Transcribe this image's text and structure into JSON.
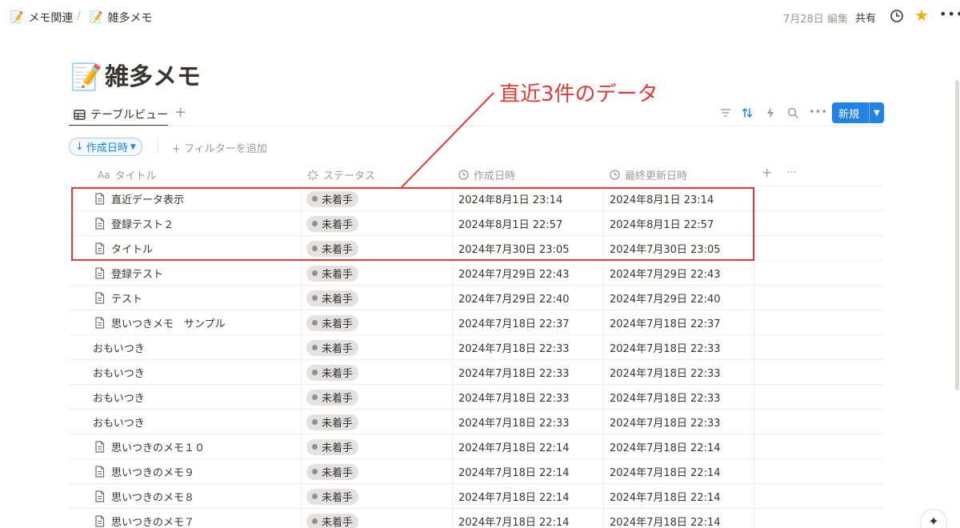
{
  "breadcrumb": [
    {
      "icon": "📝",
      "label": "メモ関連"
    },
    {
      "icon": "📝",
      "label": "雑多メモ"
    }
  ],
  "breadcrumb_separator": "/",
  "topbar": {
    "edited": "7月28日 編集",
    "share": "共有"
  },
  "page": {
    "icon": "📝",
    "title": "雑多メモ"
  },
  "view": {
    "tab_label": "テーブルビュー",
    "add": "+",
    "new_button": "新規"
  },
  "filters": {
    "sort_chip": "作成日時",
    "add_filter": "+ フィルターを追加"
  },
  "columns": {
    "title": "タイトル",
    "title_prefix": "Aa",
    "status": "ステータス",
    "created": "作成日時",
    "updated": "最終更新日時",
    "add": "+",
    "more": "···"
  },
  "rows": [
    {
      "title": "直近データ表示",
      "doc": true,
      "status": "未着手",
      "created": "2024年8月1日 23:14",
      "updated": "2024年8月1日 23:14"
    },
    {
      "title": "登録テスト２",
      "doc": true,
      "status": "未着手",
      "created": "2024年8月1日 22:57",
      "updated": "2024年8月1日 22:57"
    },
    {
      "title": "タイトル",
      "doc": true,
      "status": "未着手",
      "created": "2024年7月30日 23:05",
      "updated": "2024年7月30日 23:05"
    },
    {
      "title": "登録テスト",
      "doc": true,
      "status": "未着手",
      "created": "2024年7月29日 22:43",
      "updated": "2024年7月29日 22:43"
    },
    {
      "title": "テスト",
      "doc": true,
      "status": "未着手",
      "created": "2024年7月29日 22:40",
      "updated": "2024年7月29日 22:40"
    },
    {
      "title": "思いつきメモ　サンプル",
      "doc": true,
      "status": "未着手",
      "created": "2024年7月18日 22:37",
      "updated": "2024年7月18日 22:37"
    },
    {
      "title": "おもいつき",
      "doc": false,
      "status": "未着手",
      "created": "2024年7月18日 22:33",
      "updated": "2024年7月18日 22:33"
    },
    {
      "title": "おもいつき",
      "doc": false,
      "status": "未着手",
      "created": "2024年7月18日 22:33",
      "updated": "2024年7月18日 22:33"
    },
    {
      "title": "おもいつき",
      "doc": false,
      "status": "未着手",
      "created": "2024年7月18日 22:33",
      "updated": "2024年7月18日 22:33"
    },
    {
      "title": "おもいつき",
      "doc": false,
      "status": "未着手",
      "created": "2024年7月18日 22:33",
      "updated": "2024年7月18日 22:33"
    },
    {
      "title": "思いつきのメモ１０",
      "doc": true,
      "status": "未着手",
      "created": "2024年7月18日 22:14",
      "updated": "2024年7月18日 22:14"
    },
    {
      "title": "思いつきのメモ９",
      "doc": true,
      "status": "未着手",
      "created": "2024年7月18日 22:14",
      "updated": "2024年7月18日 22:14"
    },
    {
      "title": "思いつきのメモ８",
      "doc": true,
      "status": "未着手",
      "created": "2024年7月18日 22:14",
      "updated": "2024年7月18日 22:14"
    },
    {
      "title": "思いつきのメモ７",
      "doc": true,
      "status": "未着手",
      "created": "2024年7月18日 22:14",
      "updated": "2024年7月18日 22:14"
    }
  ],
  "annotation": {
    "text": "直近3件のデータ",
    "color": "#e53935"
  },
  "colors": {
    "accent": "#2383e2",
    "status_badge_bg": "#e3e2e0",
    "favorite_star": "#f0b000"
  }
}
